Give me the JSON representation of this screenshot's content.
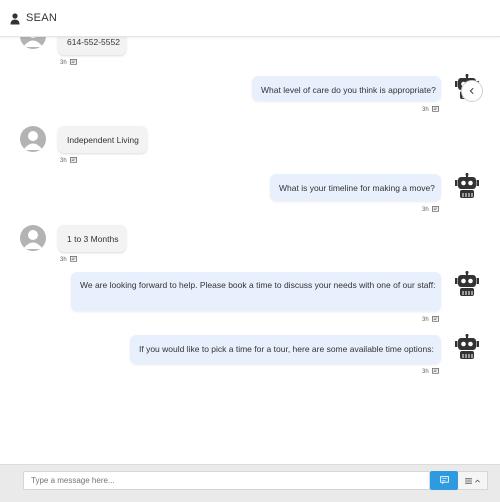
{
  "header": {
    "title": "SEAN",
    "user_icon": "user-icon"
  },
  "messages": [
    {
      "from": "user",
      "text": "614-552-5552",
      "time": "3h"
    },
    {
      "from": "bot",
      "text": "What level of care do you think is appropriate?",
      "time": "3h"
    },
    {
      "from": "user",
      "text": "Independent Living",
      "time": "3h"
    },
    {
      "from": "bot",
      "text": "What is your timeline for making a move?",
      "time": "3h"
    },
    {
      "from": "user",
      "text": "1 to 3 Months",
      "time": "3h"
    },
    {
      "from": "bot",
      "text": "We are looking forward to help. Please book a time to discuss your needs with one of our staff:",
      "time": "3h"
    },
    {
      "from": "bot",
      "text": "If you would like to pick a time for a tour, here are some available time options:",
      "time": "3h"
    }
  ],
  "composer": {
    "placeholder": "Type a message here...",
    "send_icon": "send-icon",
    "menu_icon": "menu-icon"
  },
  "colors": {
    "bot_bubble": "#e8f0fe",
    "user_bubble": "#f3f3f3",
    "send_button": "#2e9ae0"
  }
}
